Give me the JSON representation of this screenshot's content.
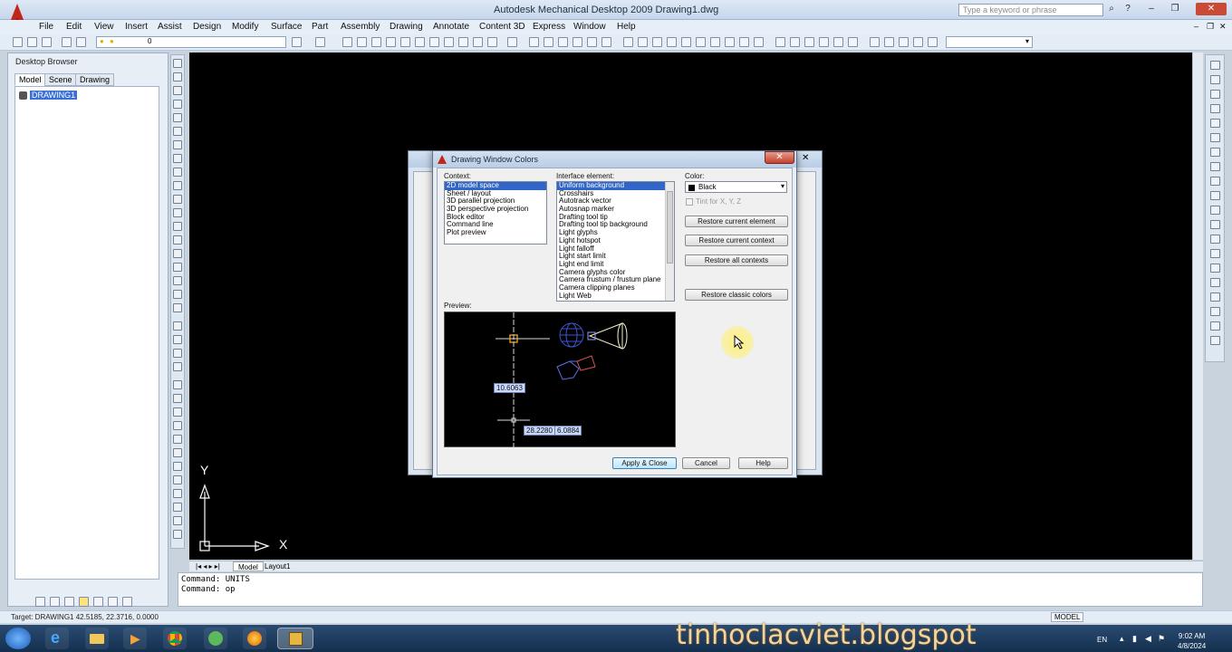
{
  "window": {
    "title": "Autodesk Mechanical Desktop 2009  Drawing1.dwg",
    "search_placeholder": "Type a keyword or phrase"
  },
  "menu": [
    "File",
    "Edit",
    "View",
    "Insert",
    "Assist",
    "Design",
    "Modify",
    "Surface",
    "Part",
    "Assembly",
    "Drawing",
    "Annotate",
    "Content 3D",
    "Express",
    "Window",
    "Help"
  ],
  "toolbar": {
    "layer_value": "0"
  },
  "browser": {
    "title": "Desktop Browser",
    "tabs": [
      "Model",
      "Scene",
      "Drawing"
    ],
    "active_tab": "Model",
    "tree_root": "DRAWING1"
  },
  "layout_tabs": [
    "Model",
    "Layout1"
  ],
  "command_line": [
    "Command: UNITS",
    "Command: op"
  ],
  "status": {
    "text": "Target: DRAWING1    42.5185, 22.3716, 0.0000",
    "model": "MODEL"
  },
  "ucs": {
    "x_label": "X",
    "y_label": "Y"
  },
  "dialog": {
    "title": "Drawing Window Colors",
    "context_label": "Context:",
    "contexts": [
      "2D model space",
      "Sheet / layout",
      "3D parallel projection",
      "3D perspective projection",
      "Block editor",
      "Command line",
      "Plot preview"
    ],
    "context_selected": "2D model space",
    "interface_label": "Interface element:",
    "interface_elements": [
      "Uniform background",
      "Crosshairs",
      "Autotrack vector",
      "Autosnap marker",
      "Drafting tool tip",
      "Drafting tool tip background",
      "Light glyphs",
      "Light hotspot",
      "Light falloff",
      "Light start limit",
      "Light end limit",
      "Camera glyphs color",
      "Camera frustum / frustum plane",
      "Camera clipping planes",
      "Light Web"
    ],
    "interface_selected": "Uniform background",
    "color_label": "Color:",
    "color_value": "Black",
    "tint_label": "Tint for X, Y, Z",
    "restore_element": "Restore current element",
    "restore_context": "Restore current context",
    "restore_all": "Restore all contexts",
    "restore_classic": "Restore classic colors",
    "preview_label": "Preview:",
    "preview_values": [
      "10.6063",
      "28.2280",
      "6.0884"
    ],
    "apply_close": "Apply & Close",
    "cancel": "Cancel",
    "help": "Help"
  },
  "taskbar": {
    "watermark": "tinhoclacviet.blogspot",
    "lang": "EN",
    "time": "9:02 AM",
    "date": "4/8/2024"
  },
  "colors": {
    "drawing_bg": "#000000",
    "selection": "#3166c8",
    "taskbar": "#1e3b5e"
  }
}
